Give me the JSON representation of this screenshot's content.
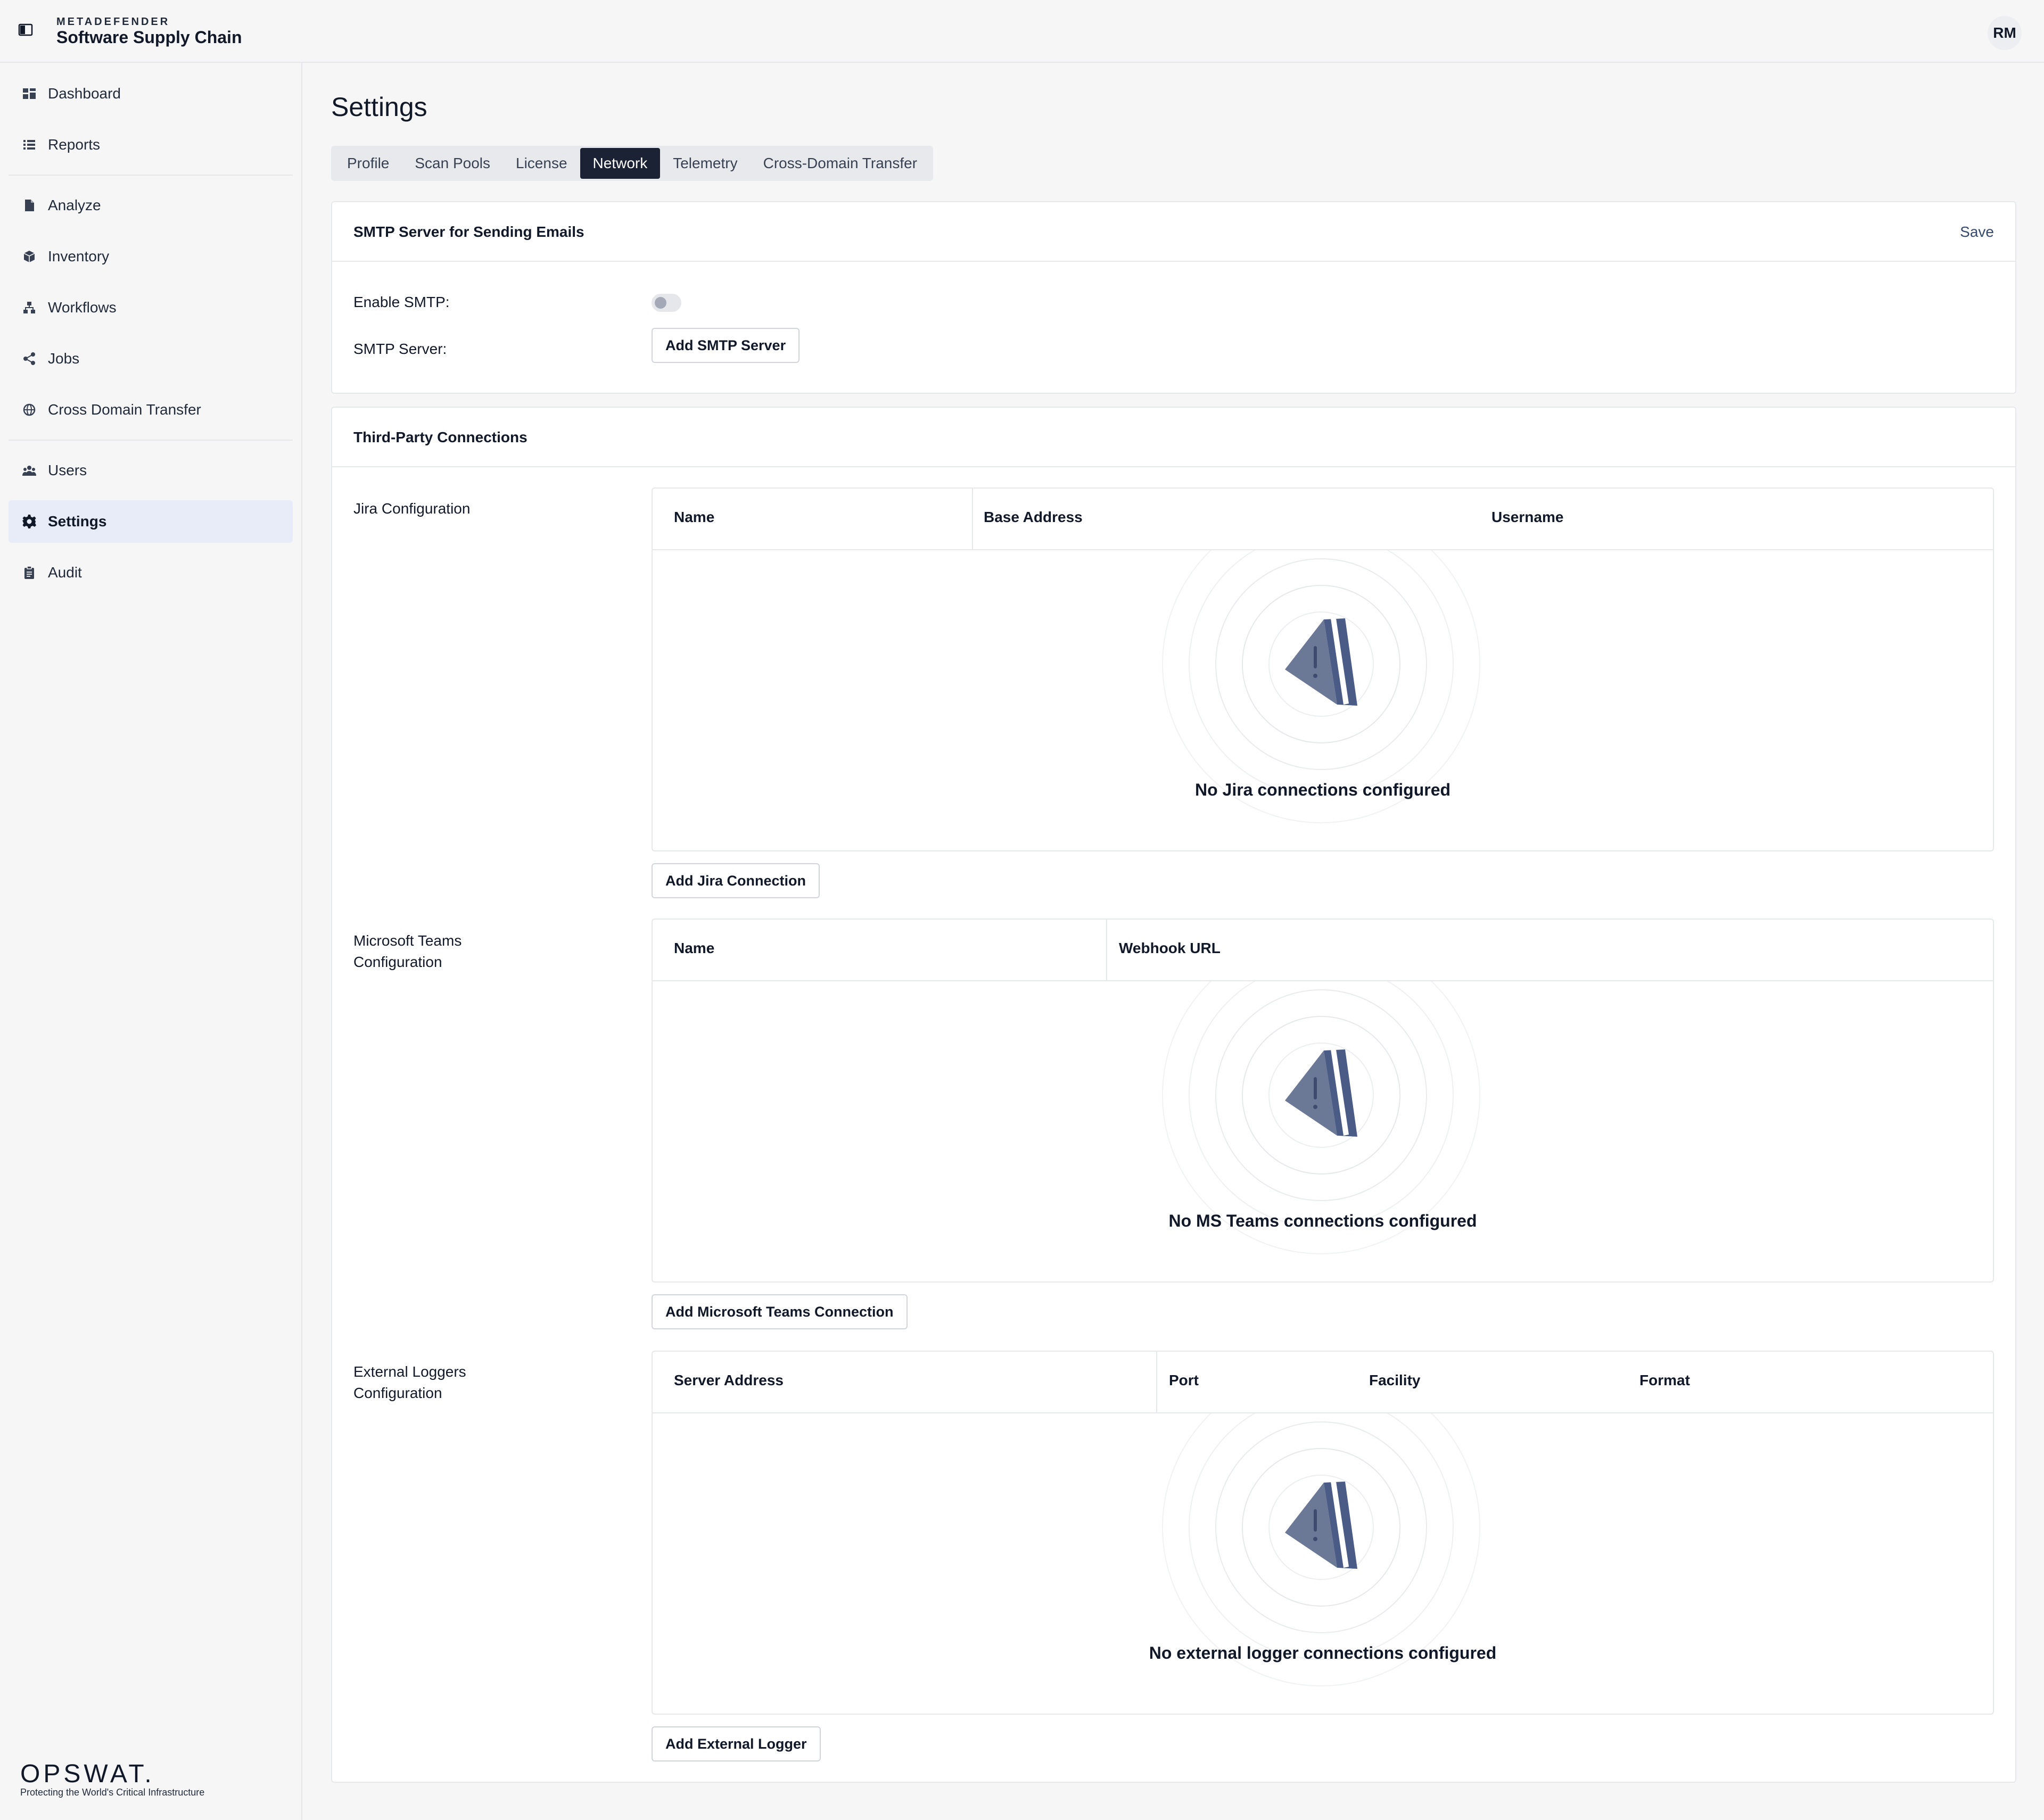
{
  "header": {
    "brand_small": "METADEFENDER",
    "brand_name": "Software Supply Chain",
    "avatar_initials": "RM"
  },
  "sidebar": {
    "items": [
      {
        "label": "Dashboard",
        "icon": "dashboard-icon"
      },
      {
        "label": "Reports",
        "icon": "list-icon"
      },
      {
        "label": "Analyze",
        "icon": "document-icon"
      },
      {
        "label": "Inventory",
        "icon": "cube-icon"
      },
      {
        "label": "Workflows",
        "icon": "workflow-icon"
      },
      {
        "label": "Jobs",
        "icon": "share-icon"
      },
      {
        "label": "Cross Domain Transfer",
        "icon": "globe-icon"
      },
      {
        "label": "Users",
        "icon": "users-icon"
      },
      {
        "label": "Settings",
        "icon": "gear-icon"
      },
      {
        "label": "Audit",
        "icon": "clipboard-icon"
      }
    ],
    "active": "Settings",
    "footer_logo": "OPSWAT.",
    "footer_tagline": "Protecting the World's Critical Infrastructure"
  },
  "main": {
    "title": "Settings",
    "tabs": [
      {
        "label": "Profile"
      },
      {
        "label": "Scan Pools"
      },
      {
        "label": "License"
      },
      {
        "label": "Network"
      },
      {
        "label": "Telemetry"
      },
      {
        "label": "Cross-Domain Transfer"
      }
    ],
    "active_tab": "Network",
    "smtp": {
      "title": "SMTP Server for Sending Emails",
      "save": "Save",
      "enable_label": "Enable SMTP:",
      "enable_value": false,
      "server_label": "SMTP Server:",
      "add_button": "Add SMTP Server"
    },
    "third_party": {
      "title": "Third-Party Connections",
      "jira": {
        "label": "Jira Configuration",
        "columns": [
          "Name",
          "Base Address",
          "Username"
        ],
        "empty": "No Jira connections configured",
        "add_button": "Add Jira Connection"
      },
      "teams": {
        "label_line1": "Microsoft Teams",
        "label_line2": "Configuration",
        "columns": [
          "Name",
          "Webhook URL"
        ],
        "empty": "No MS Teams connections configured",
        "add_button": "Add Microsoft Teams Connection"
      },
      "loggers": {
        "label_line1": "External Loggers",
        "label_line2": "Configuration",
        "columns": [
          "Server Address",
          "Port",
          "Facility",
          "Format"
        ],
        "empty": "No external logger connections configured",
        "add_button": "Add External Logger"
      }
    }
  },
  "colors": {
    "active_tab_bg": "#1a2233",
    "active_nav_bg": "#e8ecf8",
    "link": "#374a6d",
    "illustration": "#5a6a8e"
  }
}
